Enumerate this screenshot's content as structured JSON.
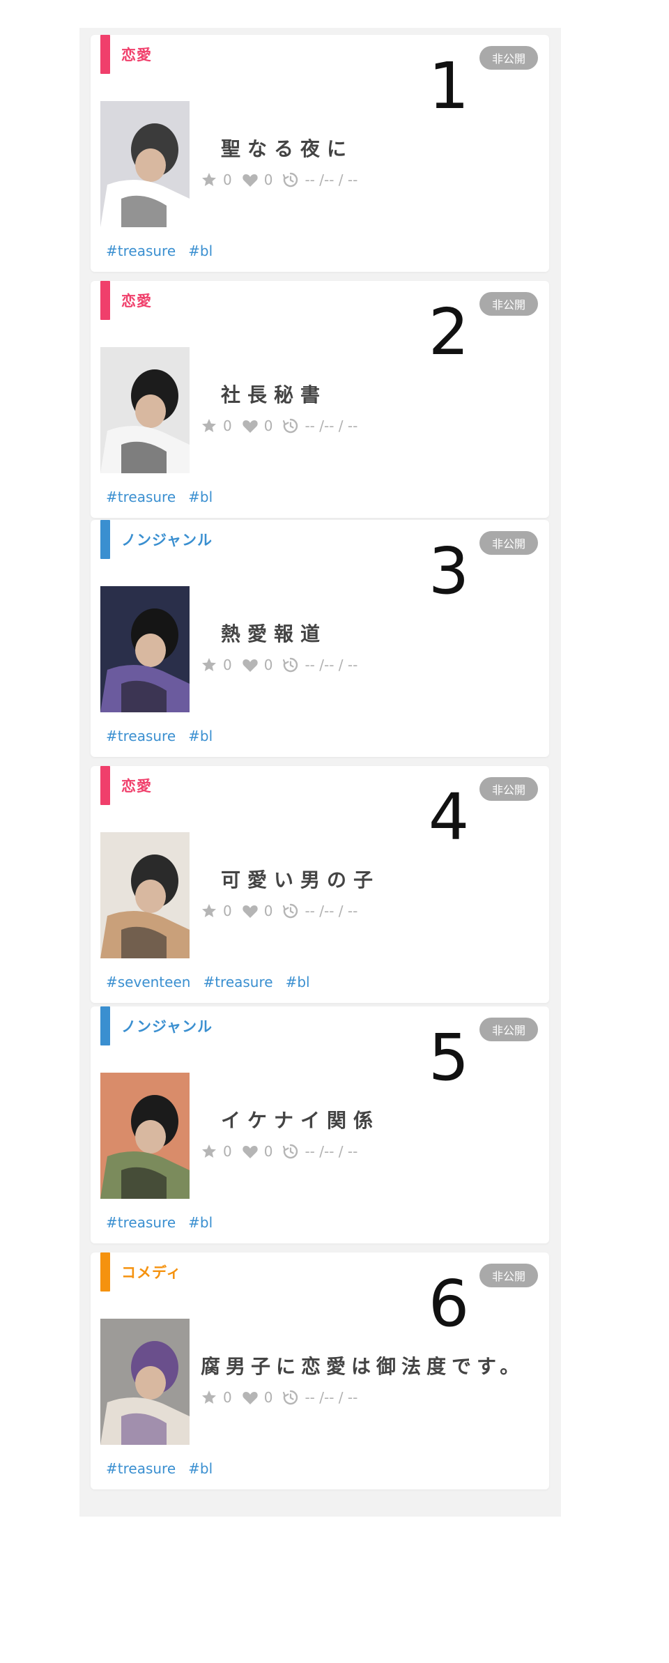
{
  "cards": [
    {
      "number": "1",
      "genre": "恋愛",
      "genre_color": "#f03f6b",
      "status": "非公開",
      "title": "聖なる夜に",
      "stars": "0",
      "likes": "0",
      "date": "-- /-- / --",
      "tags": [
        "#treasure",
        "#bl"
      ],
      "thumbnail_palette": [
        "#d9d9de",
        "#3b3b3b",
        "#ffffff"
      ]
    },
    {
      "number": "2",
      "genre": "恋愛",
      "genre_color": "#f03f6b",
      "status": "非公開",
      "title": "社長秘書",
      "stars": "0",
      "likes": "0",
      "date": "-- /-- / --",
      "tags": [
        "#treasure",
        "#bl"
      ],
      "thumbnail_palette": [
        "#e6e6e6",
        "#1c1c1c",
        "#f5f5f5"
      ]
    },
    {
      "number": "3",
      "genre": "ノンジャンル",
      "genre_color": "#3a8fd0",
      "status": "非公開",
      "title": "熱愛報道",
      "stars": "0",
      "likes": "0",
      "date": "-- /-- / --",
      "tags": [
        "#treasure",
        "#bl"
      ],
      "thumbnail_palette": [
        "#2a2f4a",
        "#151515",
        "#6b5b9e"
      ]
    },
    {
      "number": "4",
      "genre": "恋愛",
      "genre_color": "#f03f6b",
      "status": "非公開",
      "title": "可愛い男の子",
      "stars": "0",
      "likes": "0",
      "date": "-- /-- / --",
      "tags": [
        "#seventeen",
        "#treasure",
        "#bl"
      ],
      "thumbnail_palette": [
        "#e8e3dc",
        "#2a2a2a",
        "#c9a07a"
      ]
    },
    {
      "number": "5",
      "genre": "ノンジャンル",
      "genre_color": "#3a8fd0",
      "status": "非公開",
      "title": "イケナイ関係",
      "stars": "0",
      "likes": "0",
      "date": "-- /-- / --",
      "tags": [
        "#treasure",
        "#bl"
      ],
      "thumbnail_palette": [
        "#d98c6a",
        "#1b1b1b",
        "#7b8b5c"
      ]
    },
    {
      "number": "6",
      "genre": "コメディ",
      "genre_color": "#f5920f",
      "status": "非公開",
      "title": "腐男子に恋愛は御法度です。",
      "stars": "0",
      "likes": "0",
      "date": "-- /-- / --",
      "tags": [
        "#treasure",
        "#bl"
      ],
      "thumbnail_palette": [
        "#9d9b98",
        "#6a4f8c",
        "#e5ded5"
      ]
    }
  ]
}
